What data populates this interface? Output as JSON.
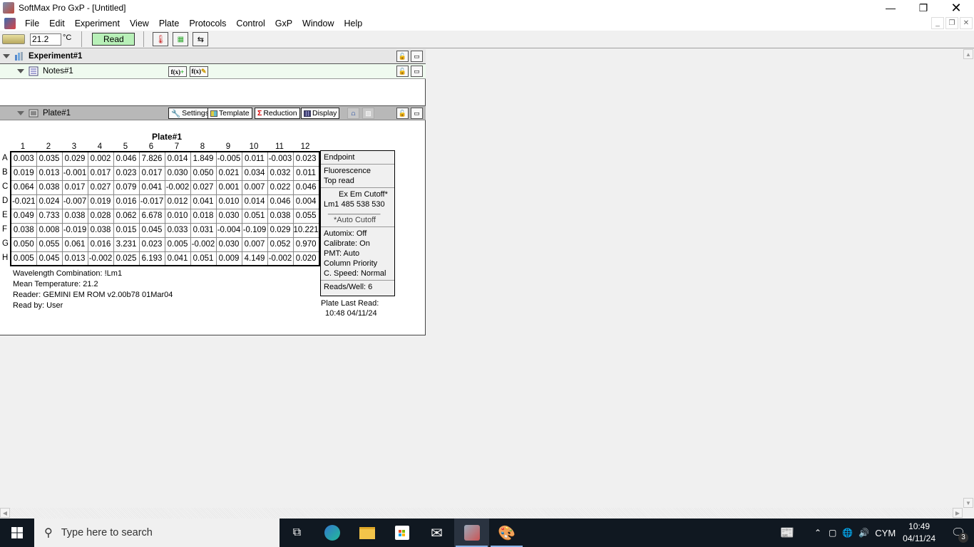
{
  "window": {
    "title": "SoftMax Pro GxP - [Untitled]",
    "minimize_icon": "minimize-icon",
    "restore_icon": "restore-icon",
    "close_icon": "close-icon"
  },
  "menubar": {
    "items": [
      "File",
      "Edit",
      "Experiment",
      "View",
      "Plate",
      "Protocols",
      "Control",
      "GxP",
      "Window",
      "Help"
    ]
  },
  "toolbar": {
    "temperature": "21.2",
    "temperature_unit": "°C",
    "read_label": "Read",
    "icons": [
      "reader-icon",
      "thermometer-icon",
      "plate-shake-icon",
      "drawer-icon"
    ],
    "read_button_color": "#b8f0b8"
  },
  "experiment": {
    "title": "Experiment#1",
    "notes": {
      "title": "Notes#1",
      "buttons": [
        "f(x)+",
        "f(x)✎"
      ]
    },
    "plate": {
      "title": "Plate#1",
      "buttons": {
        "settings": "Settings",
        "template": "Template",
        "reduction": "Reduction",
        "display": "Display"
      }
    }
  },
  "plate_view": {
    "title": "Plate#1",
    "columns": [
      "1",
      "2",
      "3",
      "4",
      "5",
      "6",
      "7",
      "8",
      "9",
      "10",
      "11",
      "12"
    ],
    "rows": [
      {
        "label": "A",
        "values": [
          "0.003",
          "0.035",
          "0.029",
          "0.002",
          "0.046",
          "7.826",
          "0.014",
          "1.849",
          "-0.005",
          "0.011",
          "-0.003",
          "0.023"
        ]
      },
      {
        "label": "B",
        "values": [
          "0.019",
          "0.013",
          "-0.001",
          "0.017",
          "0.023",
          "0.017",
          "0.030",
          "0.050",
          "0.021",
          "0.034",
          "0.032",
          "0.011"
        ]
      },
      {
        "label": "C",
        "values": [
          "0.064",
          "0.038",
          "0.017",
          "0.027",
          "0.079",
          "0.041",
          "-0.002",
          "0.027",
          "0.001",
          "0.007",
          "0.022",
          "0.046"
        ]
      },
      {
        "label": "D",
        "values": [
          "-0.021",
          "0.024",
          "-0.007",
          "0.019",
          "0.016",
          "-0.017",
          "0.012",
          "0.041",
          "0.010",
          "0.014",
          "0.046",
          "0.004"
        ]
      },
      {
        "label": "E",
        "values": [
          "0.049",
          "0.733",
          "0.038",
          "0.028",
          "0.062",
          "6.678",
          "0.010",
          "0.018",
          "0.030",
          "0.051",
          "0.038",
          "0.055"
        ]
      },
      {
        "label": "F",
        "values": [
          "0.038",
          "0.008",
          "-0.019",
          "0.038",
          "0.015",
          "0.045",
          "0.033",
          "0.031",
          "-0.004",
          "-0.109",
          "0.029",
          "10.221"
        ]
      },
      {
        "label": "G",
        "values": [
          "0.050",
          "0.055",
          "0.061",
          "0.016",
          "3.231",
          "0.023",
          "0.005",
          "-0.002",
          "0.030",
          "0.007",
          "0.052",
          "0.970"
        ]
      },
      {
        "label": "H",
        "values": [
          "0.005",
          "0.045",
          "0.013",
          "-0.002",
          "0.025",
          "6.193",
          "0.041",
          "0.051",
          "0.009",
          "4.149",
          "-0.002",
          "0.020"
        ]
      }
    ],
    "info": {
      "mode": "Endpoint",
      "read_type": "Fluorescence",
      "read_position": "Top read",
      "wl_header": "Ex  Em  Cutoff*",
      "wl_row": "Lm1 485 538  530",
      "wl_divider": "____________",
      "wl_note": "*Auto Cutoff",
      "automix": "Automix: Off",
      "calibrate": "Calibrate: On",
      "pmt": "PMT: Auto",
      "priority": "Column Priority",
      "speed": "C. Speed: Normal",
      "reads_per_well": "Reads/Well: 6"
    },
    "footer": {
      "wavelength_combination": "Wavelength Combination: !Lm1",
      "mean_temperature": "Mean Temperature: 21.2",
      "reader": "Reader: GEMINI EM ROM v2.00b78 01Mar04",
      "read_by": "Read by: User"
    },
    "last_read": {
      "label": "Plate Last Read:",
      "value": "10:48   04/11/24"
    }
  },
  "taskbar": {
    "search_placeholder": "Type here to search",
    "apps": [
      "task-view",
      "edge",
      "file-explorer",
      "microsoft-store",
      "mail",
      "softmax-pro-gxp",
      "paint"
    ],
    "tray": {
      "language": "CYM",
      "time": "10:49",
      "date": "04/11/24",
      "notification_count": "3"
    }
  }
}
